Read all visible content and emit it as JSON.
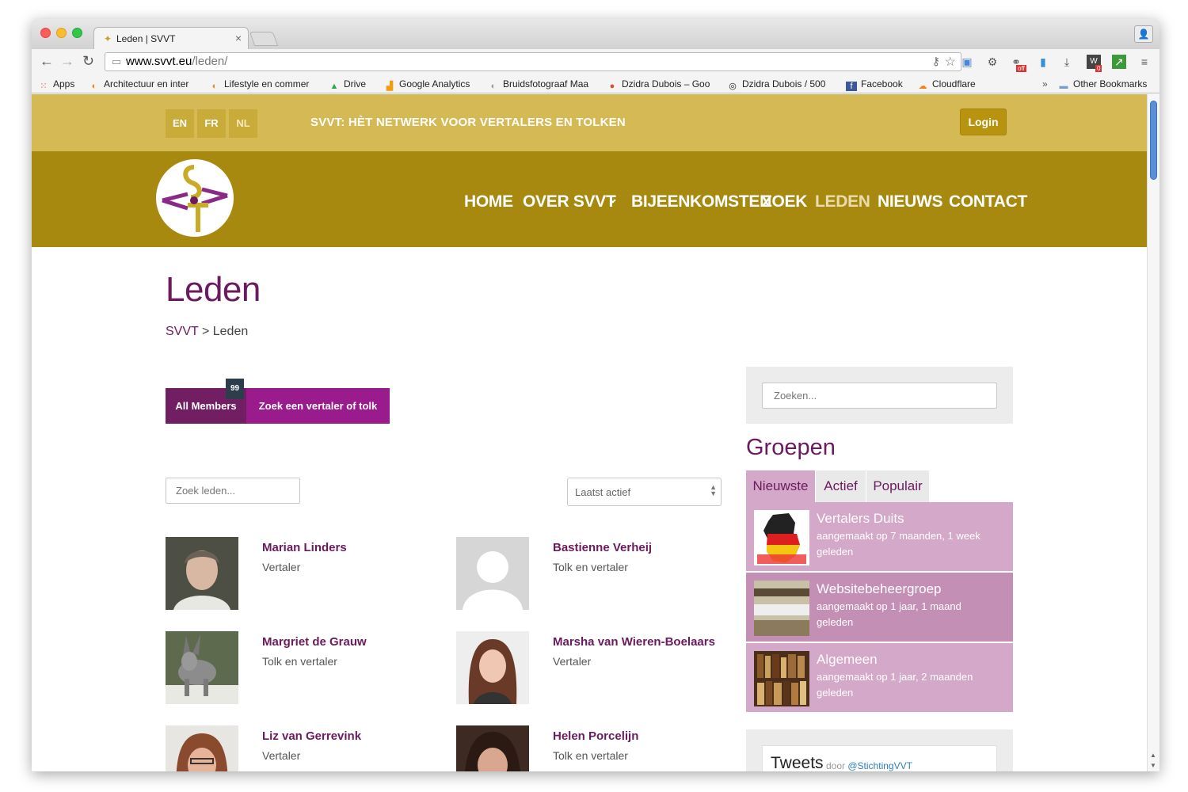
{
  "browser": {
    "tab_title": "Leden | SVVT",
    "url_host": "www.svvt.eu",
    "url_path": "/leden/",
    "bookmarks": [
      {
        "label": "Apps"
      },
      {
        "label": "Architectuur en inter"
      },
      {
        "label": "Lifestyle en commer"
      },
      {
        "label": "Drive"
      },
      {
        "label": "Google Analytics"
      },
      {
        "label": "Bruidsfotograaf Maa"
      },
      {
        "label": "Dzidra Dubois – Goo"
      },
      {
        "label": "Dzidra Dubois / 500"
      },
      {
        "label": "Facebook"
      },
      {
        "label": "Cloudflare"
      }
    ],
    "bookmarks_overflow": "»",
    "other_bookmarks": "Other Bookmarks",
    "ext_badges": {
      "off": "off",
      "zero": "0"
    }
  },
  "site": {
    "languages": [
      "EN",
      "FR",
      "NL"
    ],
    "tagline": "SVVT: HÈT NETWERK VOOR VERTALERS EN TOLKEN",
    "login_label": "Login",
    "nav": [
      "HOME",
      "OVER SVVT",
      "BIJEENKOMSTEN",
      "ZOEK",
      "LEDEN",
      "NIEUWS",
      "CONTACT"
    ],
    "nav_dropdown_icon": "⌄",
    "colors": {
      "topbar": "#d4b955",
      "navbar": "#a8890f",
      "accent": "#6b1a5e",
      "magenta": "#9a1c8c"
    }
  },
  "page": {
    "title": "Leden",
    "breadcrumb_root": "SVVT",
    "breadcrumb_sep": ">",
    "breadcrumb_current": "Leden"
  },
  "members_tabs": {
    "all_label": "All Members",
    "count": "99",
    "find_label": "Zoek een vertaler of tolk"
  },
  "members_filter": {
    "search_placeholder": "Zoek leden...",
    "sort_value": "Laatst actief"
  },
  "members": [
    {
      "name": "Marian Linders",
      "role": "Vertaler"
    },
    {
      "name": "Bastienne Verheij",
      "role": "Tolk en vertaler"
    },
    {
      "name": "Margriet de Grauw",
      "role": "Tolk en vertaler"
    },
    {
      "name": "Marsha van Wieren-Boelaars",
      "role": "Vertaler"
    },
    {
      "name": "Liz van Gerrevink",
      "role": "Vertaler"
    },
    {
      "name": "Helen Porcelijn",
      "role": "Tolk en vertaler"
    }
  ],
  "sidebar": {
    "search_placeholder": "Zoeken...",
    "groups_title": "Groepen",
    "group_tabs": [
      "Nieuwste",
      "Actief",
      "Populair"
    ],
    "groups": [
      {
        "name": "Vertalers Duits",
        "meta": "aangemaakt op 7 maanden, 1 week geleden"
      },
      {
        "name": "Websitebeheergroep",
        "meta": "aangemaakt op 1 jaar, 1 maand geleden"
      },
      {
        "name": "Algemeen",
        "meta": "aangemaakt op 1 jaar, 2 maanden geleden"
      }
    ],
    "tweets_title": "Tweets",
    "tweets_by": "door",
    "tweets_handle": "@StichtingVVT"
  }
}
